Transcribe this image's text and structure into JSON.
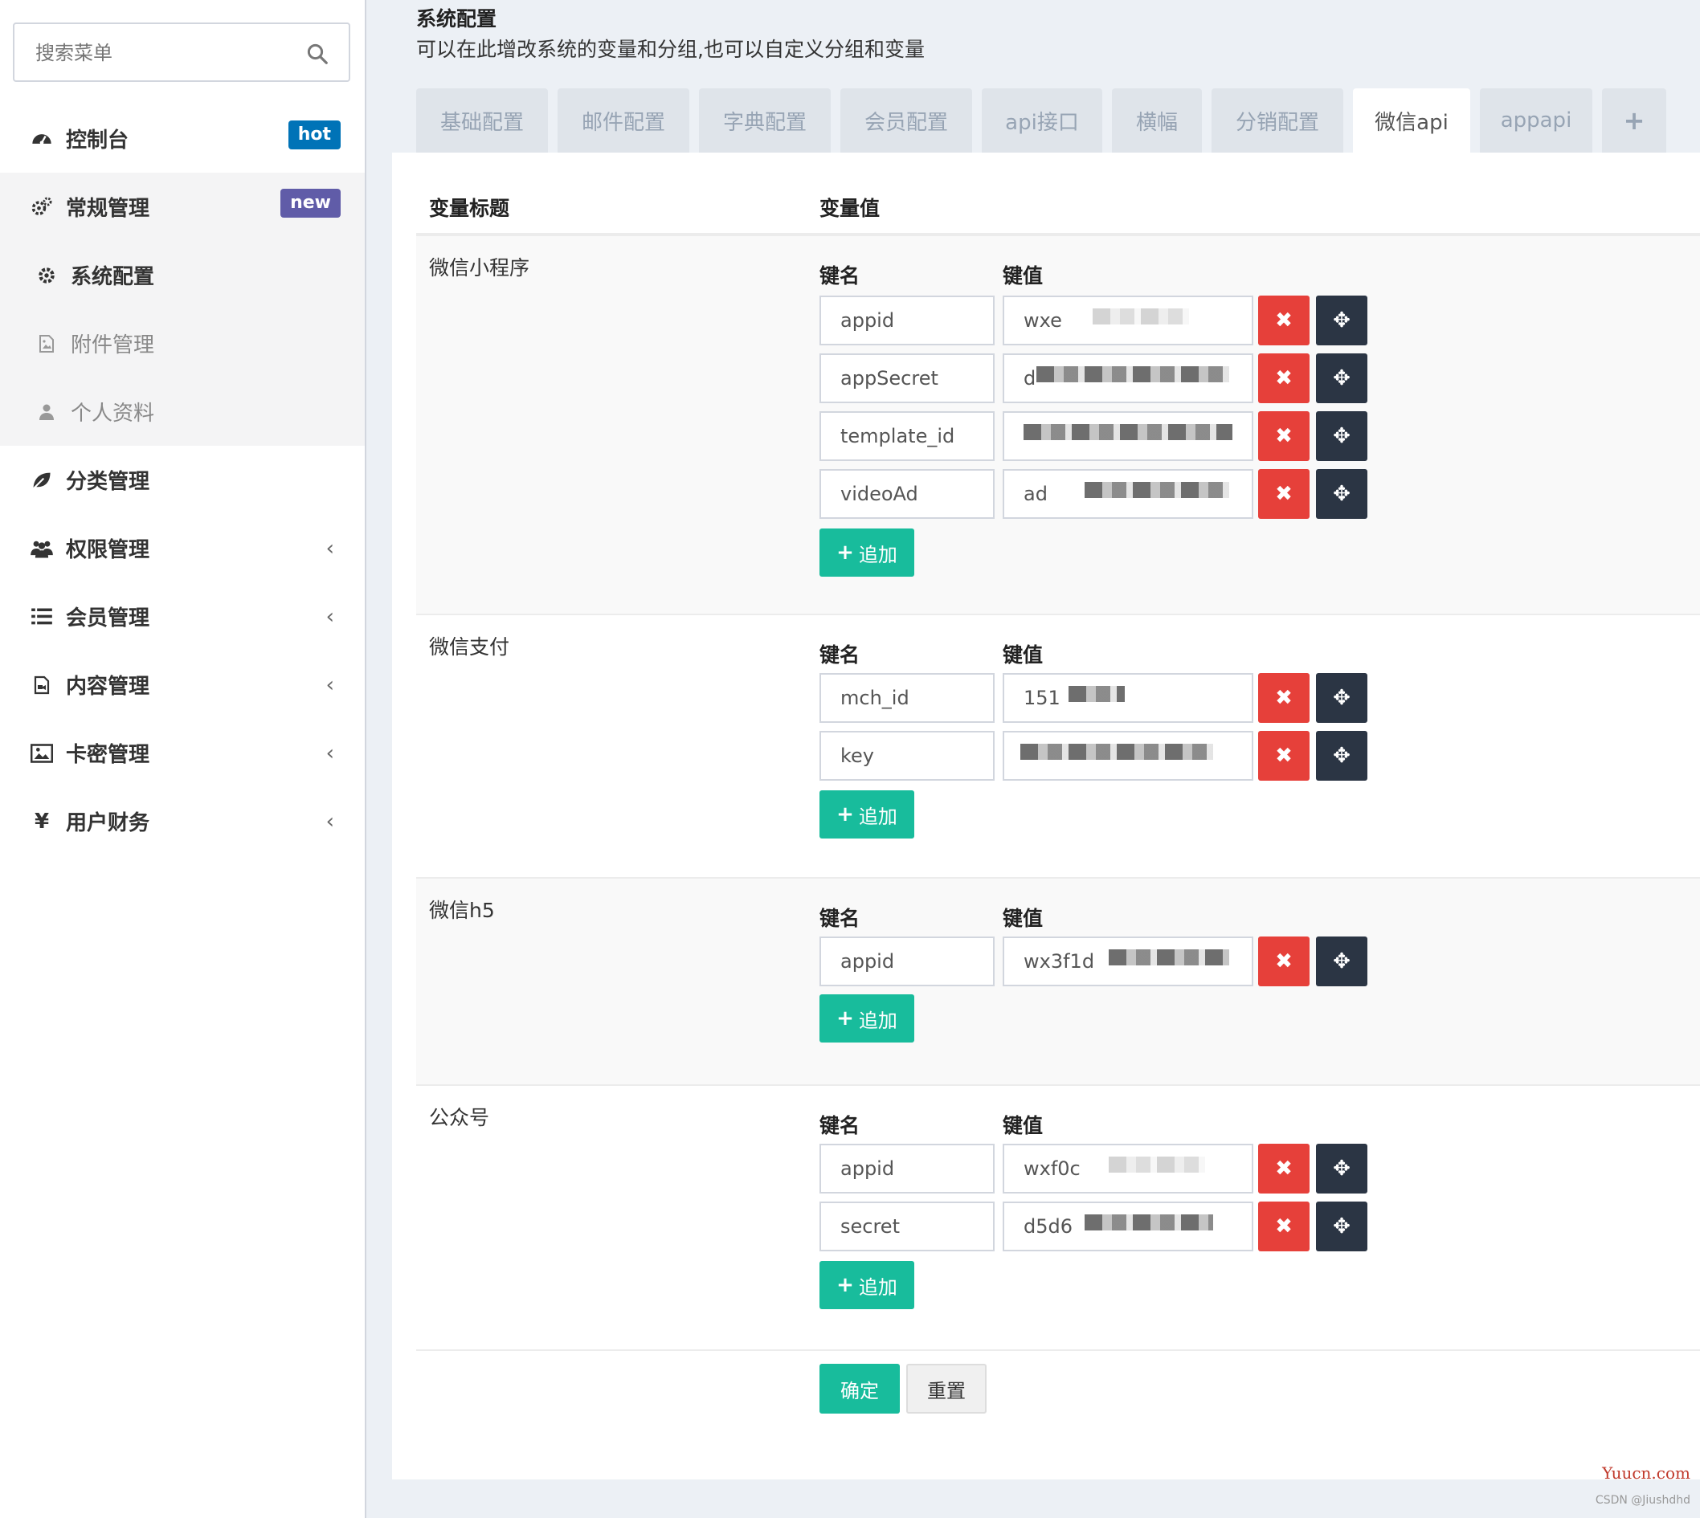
{
  "sidebar": {
    "search_placeholder": "搜索菜单",
    "items": [
      {
        "label": "控制台",
        "icon": "dashboard-icon",
        "badge": "hot"
      },
      {
        "label": "常规管理",
        "icon": "cogs-icon",
        "badge": "new"
      },
      {
        "label": "系统配置",
        "icon": "gear-icon"
      },
      {
        "label": "附件管理",
        "icon": "file-image-icon"
      },
      {
        "label": "个人资料",
        "icon": "user-icon"
      },
      {
        "label": "分类管理",
        "icon": "leaf-icon"
      },
      {
        "label": "权限管理",
        "icon": "users-icon",
        "chevron": "‹"
      },
      {
        "label": "会员管理",
        "icon": "list-icon",
        "chevron": "‹"
      },
      {
        "label": "内容管理",
        "icon": "file-video-icon",
        "chevron": "‹"
      },
      {
        "label": "卡密管理",
        "icon": "picture-icon",
        "chevron": "‹"
      },
      {
        "label": "用户财务",
        "icon": "yen-icon",
        "icon_glyph": "¥",
        "chevron": "‹"
      }
    ]
  },
  "header": {
    "title": "系统配置",
    "description": "可以在此增改系统的变量和分组,也可以自定义分组和变量"
  },
  "tabs": [
    {
      "label": "基础配置"
    },
    {
      "label": "邮件配置"
    },
    {
      "label": "字典配置"
    },
    {
      "label": "会员配置"
    },
    {
      "label": "api接口"
    },
    {
      "label": "横幅"
    },
    {
      "label": "分销配置"
    },
    {
      "label": "微信api",
      "active": true
    },
    {
      "label": "appapi"
    },
    {
      "label": "+"
    }
  ],
  "table": {
    "col_title": "变量标题",
    "col_value": "变量值",
    "key_header": "键名",
    "value_header": "键值",
    "add_label": "追加",
    "del_glyph": "✖",
    "move_glyph": "✥",
    "groups": [
      {
        "title": "微信小程序",
        "rows": [
          {
            "key": "appid",
            "value": "wxe"
          },
          {
            "key": "appSecret",
            "value": "d"
          },
          {
            "key": "template_id",
            "value": ""
          },
          {
            "key": "videoAd",
            "value": "ad"
          }
        ]
      },
      {
        "title": "微信支付",
        "rows": [
          {
            "key": "mch_id",
            "value": "151"
          },
          {
            "key": "key",
            "value": ""
          }
        ]
      },
      {
        "title": "微信h5",
        "rows": [
          {
            "key": "appid",
            "value": "wx3f1d"
          }
        ]
      },
      {
        "title": "公众号",
        "rows": [
          {
            "key": "appid",
            "value": "wxf0c"
          },
          {
            "key": "secret",
            "value": "d5d6"
          }
        ]
      }
    ]
  },
  "footer": {
    "confirm_label": "确定",
    "reset_label": "重置"
  },
  "watermark": "Yuucn.com",
  "credit": "CSDN @Jiushdhd"
}
